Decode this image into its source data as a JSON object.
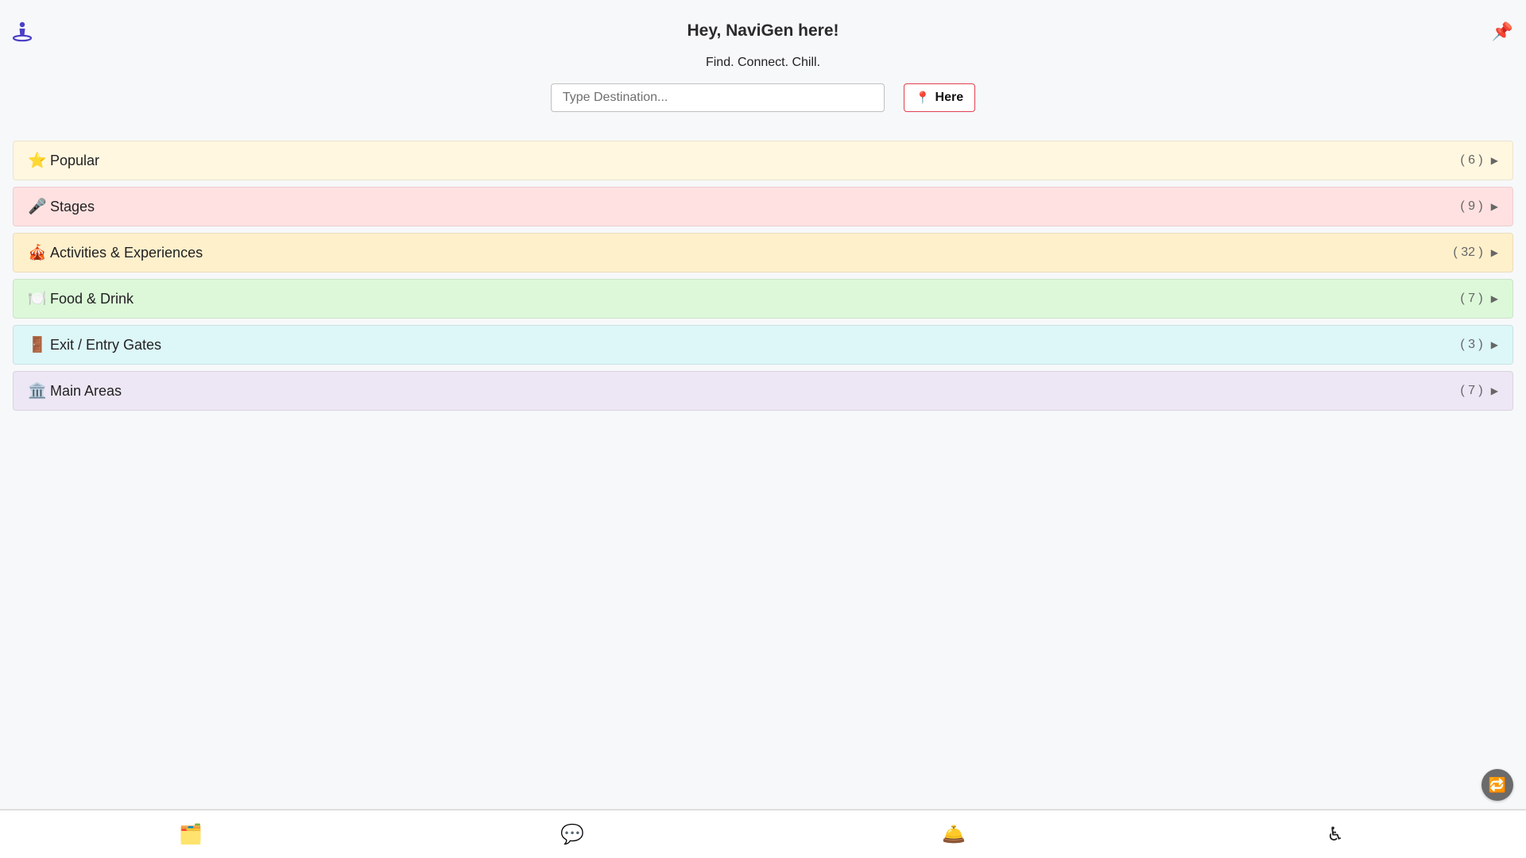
{
  "header": {
    "title": "Hey, NaviGen here!",
    "tagline": "Find. Connect. Chill.",
    "logo_icon": "person-location-icon",
    "pin_icon": "📌"
  },
  "search": {
    "placeholder": "Type Destination...",
    "value": "",
    "here_icon": "📍",
    "here_label": "Here"
  },
  "categories": [
    {
      "emoji": "⭐",
      "label": "Popular",
      "count": "( 6 )",
      "arrow": "▶",
      "color": "#fff7e0"
    },
    {
      "emoji": "🎤",
      "label": "Stages",
      "count": "( 9 )",
      "arrow": "▶",
      "color": "#ffe1e1"
    },
    {
      "emoji": "🎪",
      "label": "Activities & Experiences",
      "count": "( 32 )",
      "arrow": "▶",
      "color": "#fff0cc"
    },
    {
      "emoji": "🍽️",
      "label": "Food & Drink",
      "count": "( 7 )",
      "arrow": "▶",
      "color": "#dcf8d9"
    },
    {
      "emoji": "🚪",
      "label": "Exit / Entry Gates",
      "count": "( 3 )",
      "arrow": "▶",
      "color": "#ddf6f8"
    },
    {
      "emoji": "🏛️",
      "label": "Main Areas",
      "count": "( 7 )",
      "arrow": "▶",
      "color": "#ede6f4"
    }
  ],
  "floating_button": {
    "icon": "🔁"
  },
  "bottom_nav": [
    {
      "icon": "🗂️",
      "name": "folders"
    },
    {
      "icon": "💬",
      "name": "chat"
    },
    {
      "icon": "🛎️",
      "name": "bell"
    },
    {
      "icon": "♿",
      "name": "accessibility"
    }
  ]
}
